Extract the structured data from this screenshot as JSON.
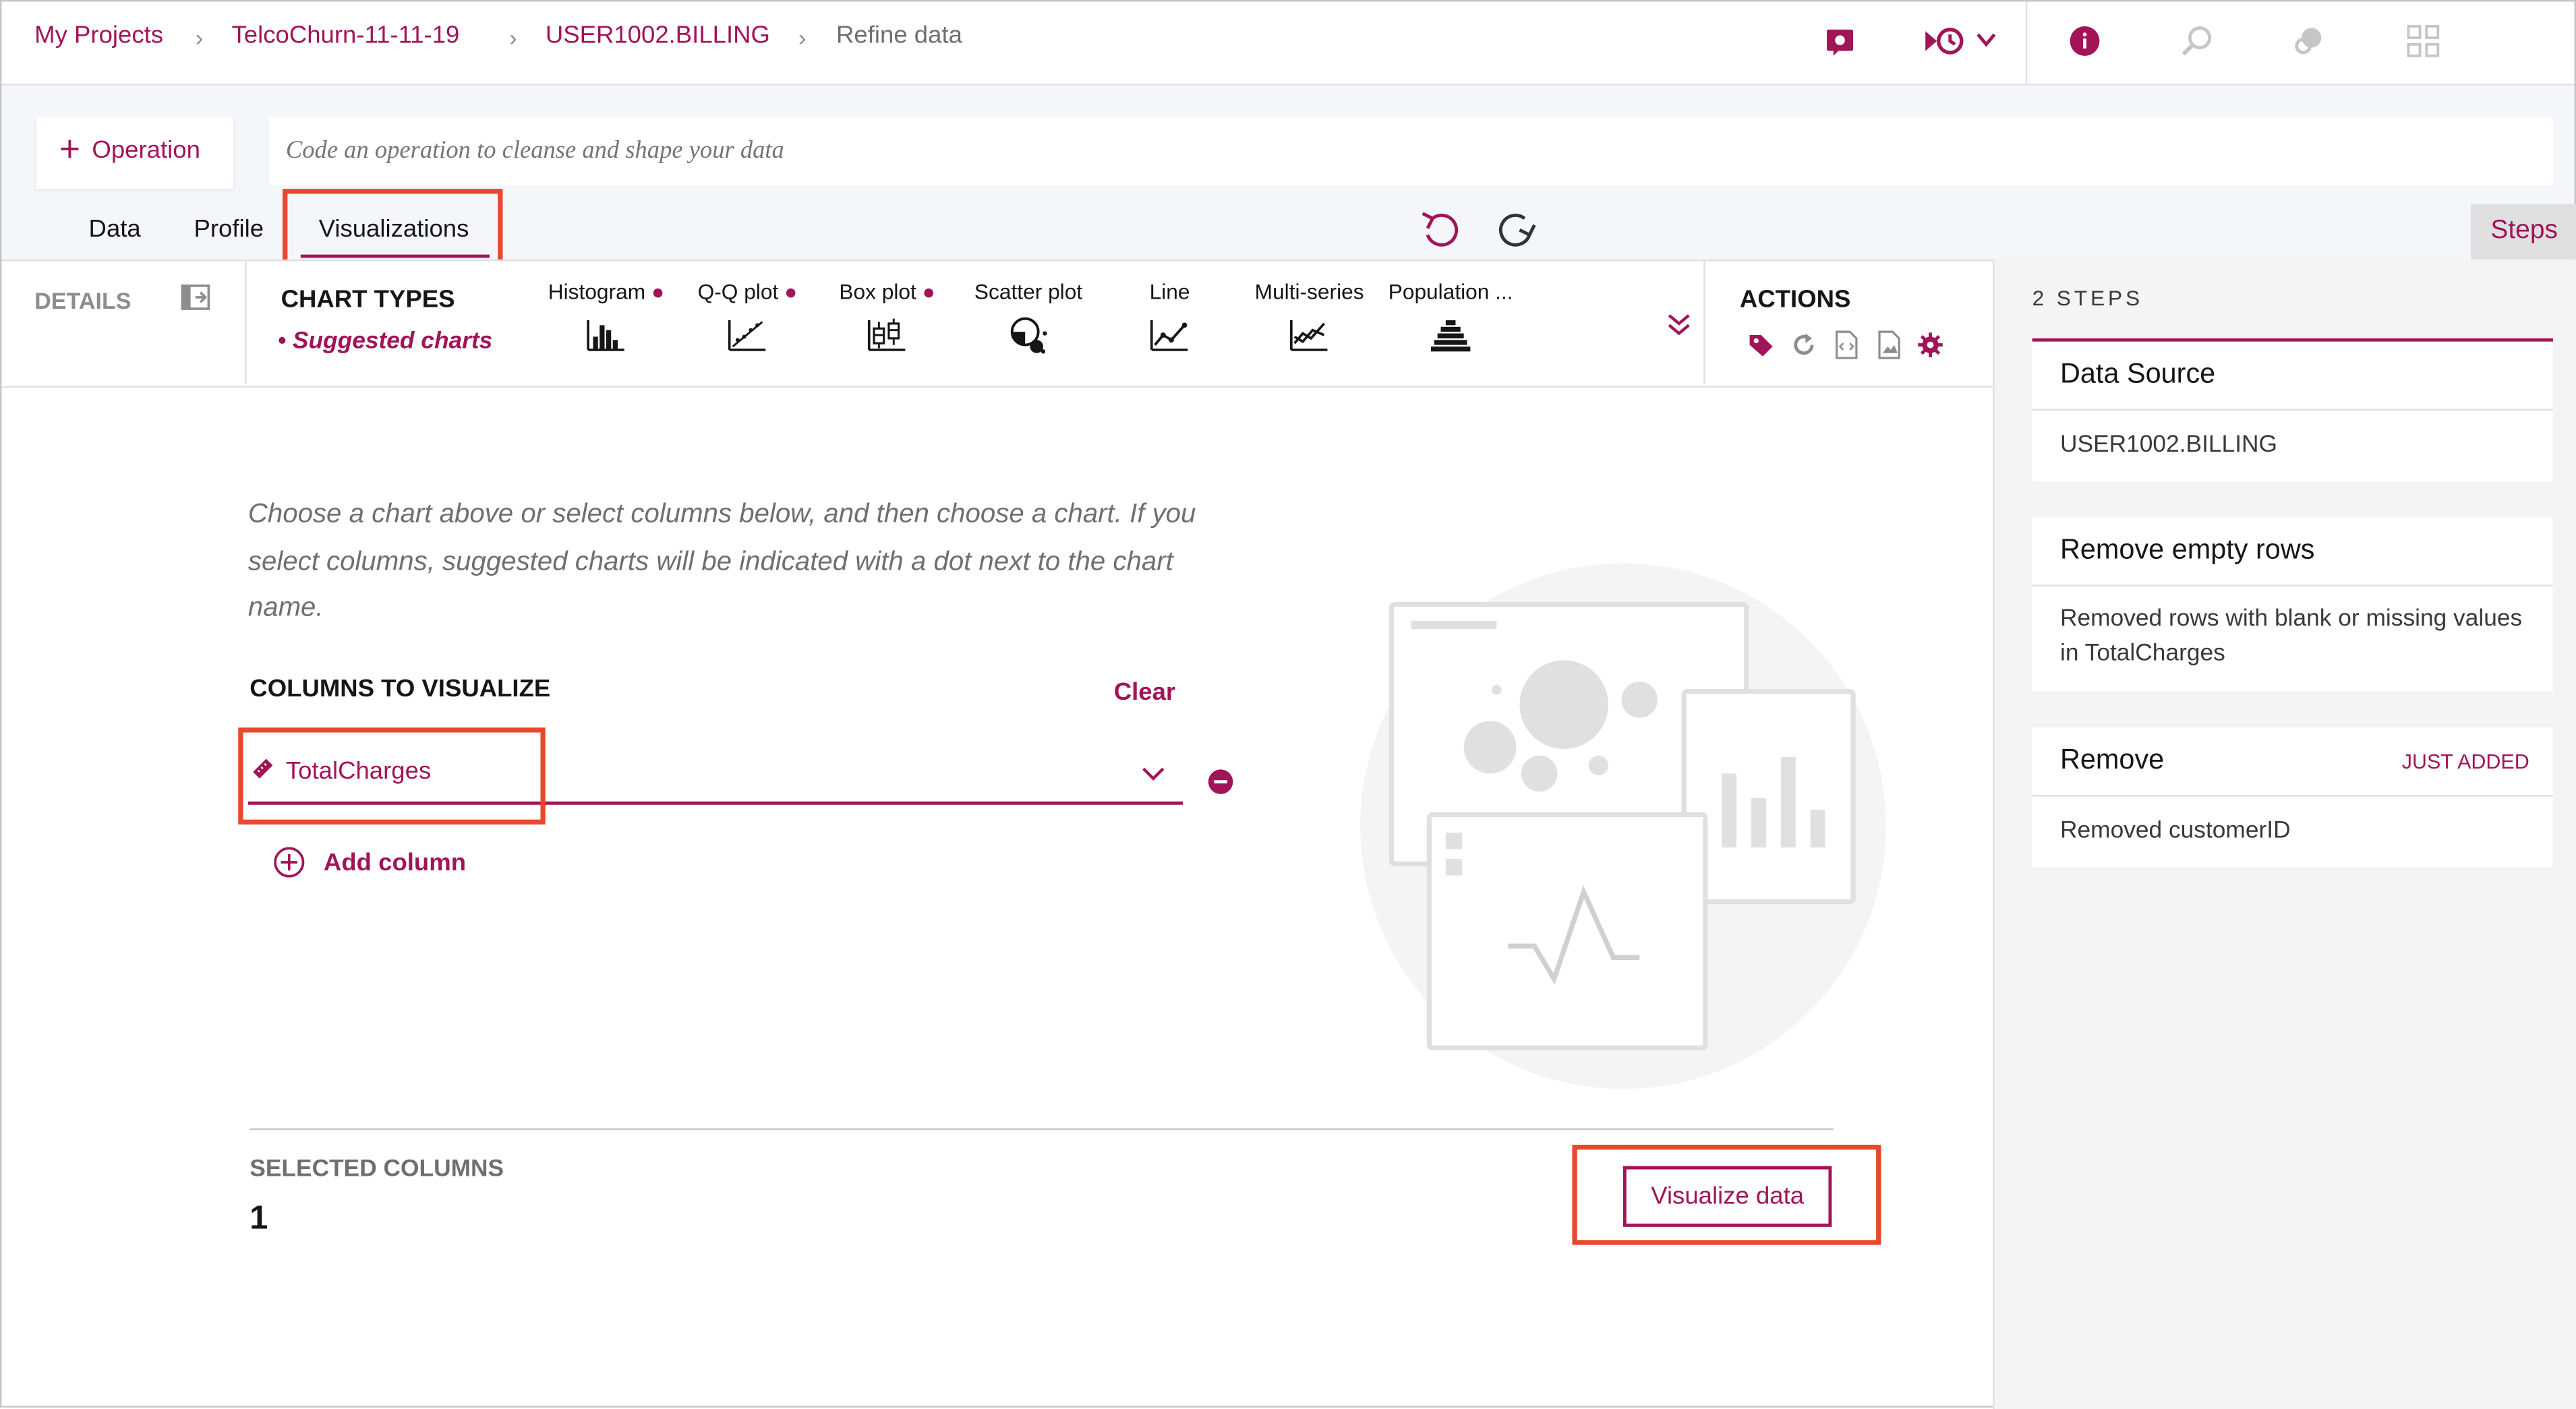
{
  "breadcrumb": {
    "items": [
      "My Projects",
      "TelcoChurn-11-11-19",
      "USER1002.BILLING",
      "Refine data"
    ]
  },
  "operation": {
    "button_label": "Operation",
    "input_placeholder": "Code an operation to cleanse and shape your data"
  },
  "tabs": {
    "data": "Data",
    "profile": "Profile",
    "visualizations": "Visualizations",
    "steps": "Steps"
  },
  "details": {
    "label": "DETAILS"
  },
  "chart_types": {
    "heading": "CHART TYPES",
    "suggested": "Suggested charts",
    "items": [
      {
        "label": "Histogram",
        "suggested": true,
        "icon": "histogram-icon"
      },
      {
        "label": "Q-Q plot",
        "suggested": true,
        "icon": "qq-plot-icon"
      },
      {
        "label": "Box plot",
        "suggested": true,
        "icon": "box-plot-icon"
      },
      {
        "label": "Scatter plot",
        "suggested": false,
        "icon": "scatter-plot-icon"
      },
      {
        "label": "Line",
        "suggested": false,
        "icon": "line-chart-icon"
      },
      {
        "label": "Multi-series",
        "suggested": false,
        "icon": "multi-series-icon"
      },
      {
        "label": "Population ...",
        "suggested": false,
        "icon": "population-pyramid-icon"
      }
    ]
  },
  "actions": {
    "heading": "ACTIONS"
  },
  "main": {
    "instructions": "Choose a chart above or select columns below, and then choose a chart. If you select columns, suggested charts will be indicated with a dot next to the chart name.",
    "columns_heading": "COLUMNS TO VISUALIZE",
    "clear_label": "Clear",
    "column_value": "TotalCharges",
    "add_column_label": "Add column",
    "selected_heading": "SELECTED COLUMNS",
    "selected_count": "1",
    "visualize_label": "Visualize data"
  },
  "steps_panel": {
    "count_label": "2 STEPS",
    "steps": [
      {
        "title": "Data Source",
        "badge": "",
        "body": "USER1002.BILLING"
      },
      {
        "title": "Remove empty rows",
        "badge": "",
        "body": "Removed rows with blank or missing values in TotalCharges"
      },
      {
        "title": "Remove",
        "badge": "JUST ADDED",
        "body": "Removed customerID"
      }
    ]
  },
  "colors": {
    "accent": "#a11458",
    "highlight_box": "#e8482c",
    "panel_bg": "#f4f4f4"
  }
}
